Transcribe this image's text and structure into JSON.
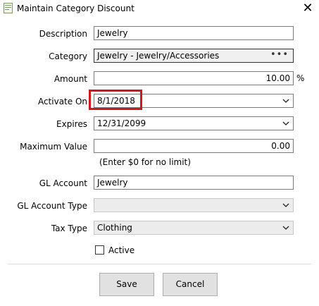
{
  "window": {
    "title": "Maintain Category Discount"
  },
  "icons": {
    "app": "app-icon",
    "close": "close-icon",
    "chevron": "chevron-down-icon",
    "browse": "ellipsis-icon"
  },
  "colors": {
    "highlight_border": "#d0171b",
    "disabled_field": "#ececec",
    "button_bg": "#e1e1e1"
  },
  "form": {
    "description": {
      "label": "Description",
      "value": "Jewelry"
    },
    "category": {
      "label": "Category",
      "value": "Jewelry - Jewelry/Accessories",
      "browse_label": "•••"
    },
    "amount": {
      "label": "Amount",
      "value": "10.00",
      "unit": "%"
    },
    "activate_on": {
      "label": "Activate On",
      "value": "8/1/2018"
    },
    "expires": {
      "label": "Expires",
      "value": "12/31/2099"
    },
    "maximum_value": {
      "label": "Maximum Value",
      "value": "0.00",
      "hint": "(Enter $0 for no limit)"
    },
    "gl_account": {
      "label": "GL Account",
      "value": "Jewelry"
    },
    "gl_account_type": {
      "label": "GL Account Type",
      "value": ""
    },
    "tax_type": {
      "label": "Tax Type",
      "value": "Clothing"
    },
    "active": {
      "label": "Active",
      "checked": false
    }
  },
  "buttons": {
    "save": "Save",
    "cancel": "Cancel"
  }
}
